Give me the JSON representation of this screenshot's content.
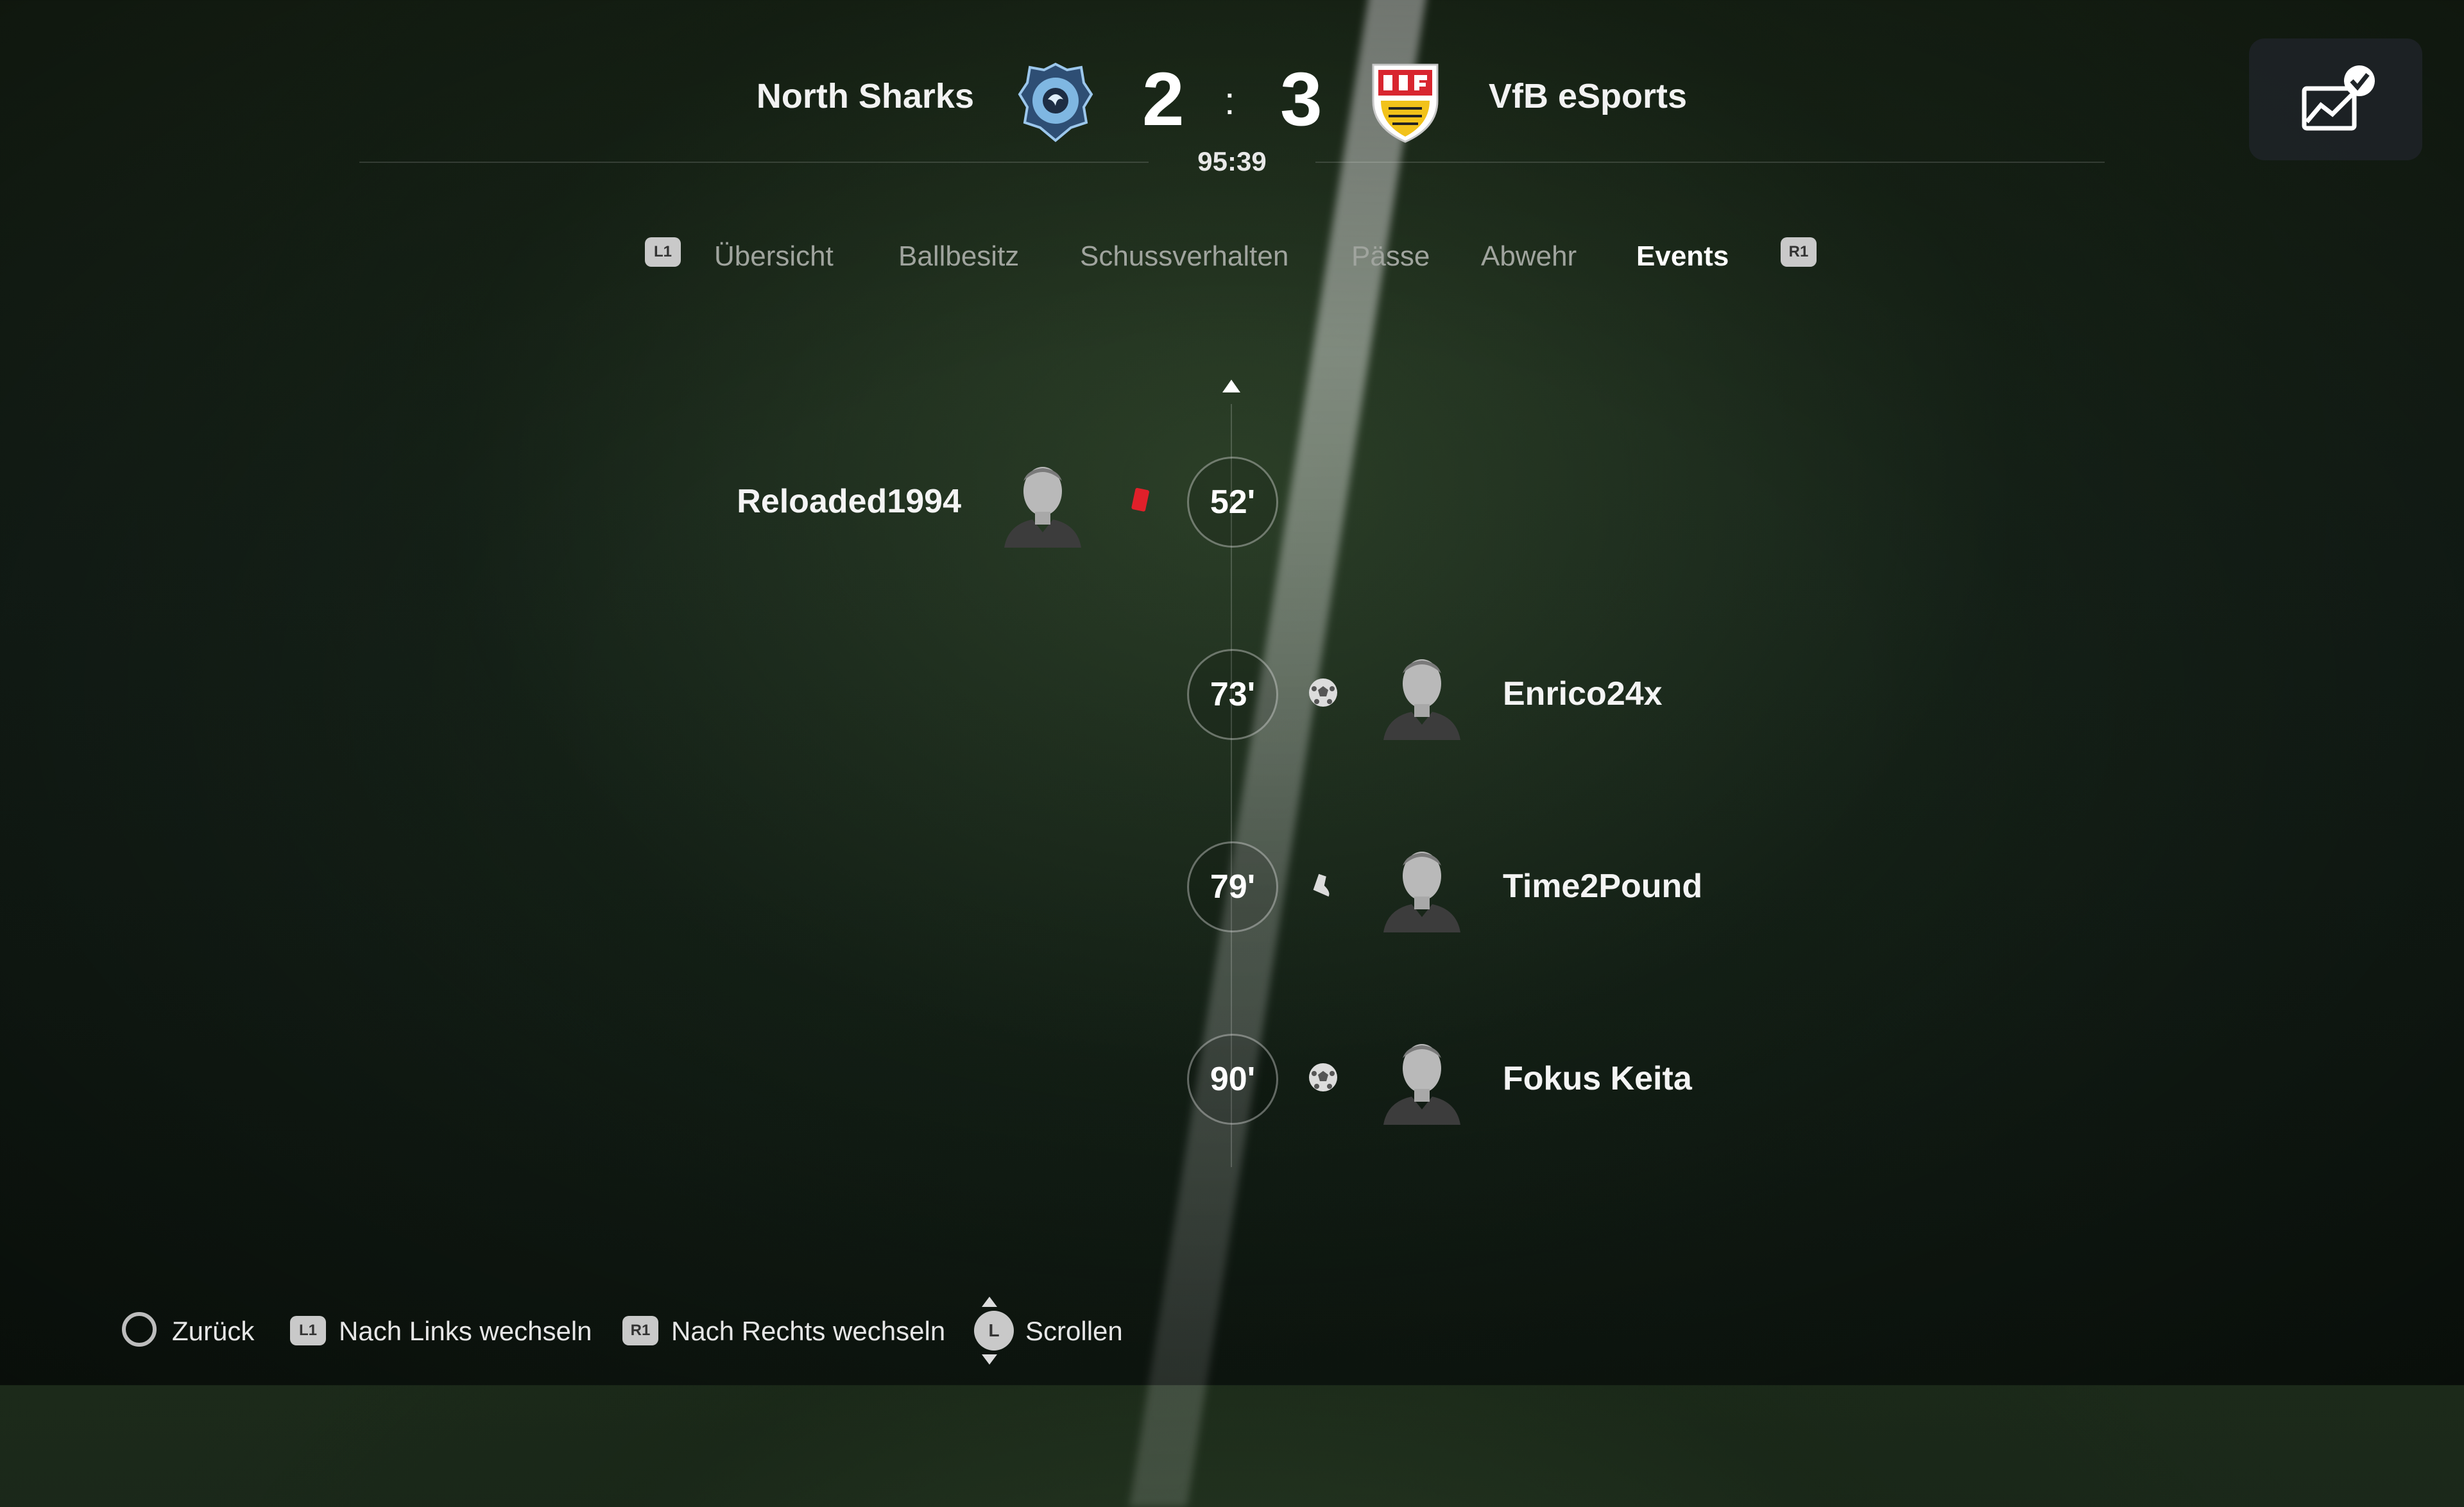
{
  "header": {
    "home_team": "North Sharks",
    "away_team": "VfB eSports",
    "home_score": "2",
    "away_score": "3",
    "separator": ":",
    "match_clock": "95:39"
  },
  "tabs": {
    "left_button": "L1",
    "right_button": "R1",
    "items": [
      {
        "label": "Übersicht"
      },
      {
        "label": "Ballbesitz"
      },
      {
        "label": "Schussverhalten"
      },
      {
        "label": "Pässe"
      },
      {
        "label": "Abwehr"
      },
      {
        "label": "Events",
        "active": true
      }
    ]
  },
  "events": [
    {
      "minute": "52'",
      "player": "Reloaded1994",
      "side": "home",
      "icon": "red-card-icon"
    },
    {
      "minute": "73'",
      "player": "Enrico24x",
      "side": "away",
      "icon": "goal-ball-icon"
    },
    {
      "minute": "79'",
      "player": "Time2Pound",
      "side": "away",
      "icon": "assist-boot-icon"
    },
    {
      "minute": "90'",
      "player": "Fokus Keita",
      "side": "away",
      "icon": "goal-ball-icon"
    }
  ],
  "footer": {
    "back": "Zurück",
    "l1_badge": "L1",
    "switch_left": "Nach Links wechseln",
    "r1_badge": "R1",
    "switch_right": "Nach Rechts wechseln",
    "stick_badge": "L",
    "scroll": "Scrollen"
  },
  "colors": {
    "accent_red_card": "#e0202a",
    "active_tab": "#ffffff",
    "inactive_tab": "#a0a49e",
    "home_crest": "#6aa6d6",
    "away_crest": "#d8262f"
  }
}
